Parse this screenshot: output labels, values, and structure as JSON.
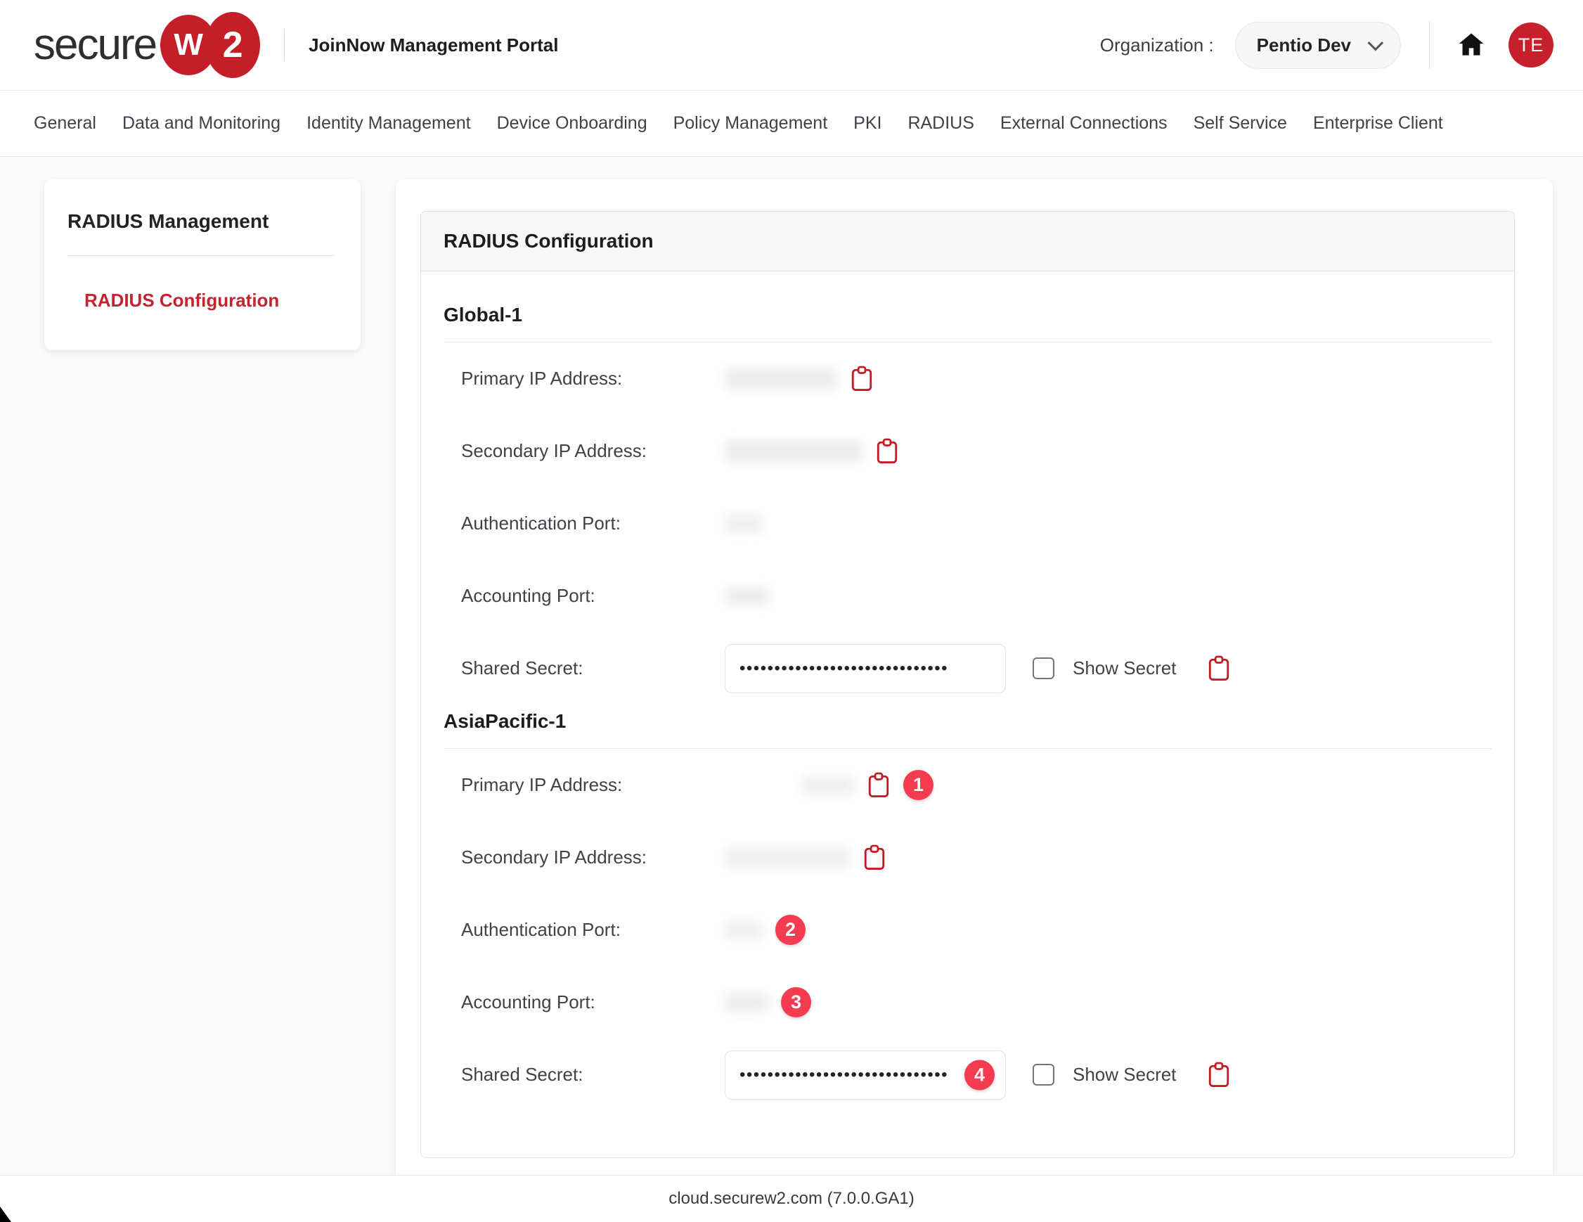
{
  "brand": {
    "logo_word": "secure",
    "logo_w": "W",
    "logo_2": "2",
    "portal_title": "JoinNow Management Portal"
  },
  "header": {
    "organization_label": "Organization :",
    "organization_value": "Pentio Dev",
    "avatar_initials": "TE"
  },
  "nav": {
    "items": [
      {
        "label": "General"
      },
      {
        "label": "Data and Monitoring"
      },
      {
        "label": "Identity Management"
      },
      {
        "label": "Device Onboarding"
      },
      {
        "label": "Policy Management"
      },
      {
        "label": "PKI"
      },
      {
        "label": "RADIUS"
      },
      {
        "label": "External Connections"
      },
      {
        "label": "Self Service"
      },
      {
        "label": "Enterprise Client"
      }
    ]
  },
  "sidebar": {
    "title": "RADIUS Management",
    "items": [
      {
        "label": "RADIUS Configuration",
        "active": true
      }
    ]
  },
  "main": {
    "panel_title": "RADIUS Configuration",
    "sections": [
      {
        "name": "Global-1",
        "rows": [
          {
            "label": "Primary IP Address:",
            "value": "redacted",
            "clipboard": true
          },
          {
            "label": "Secondary IP Address:",
            "value": "redacted",
            "clipboard": true
          },
          {
            "label": "Authentication Port:",
            "value": "redacted"
          },
          {
            "label": "Accounting Port:",
            "value": "redacted"
          },
          {
            "label": "Shared Secret:",
            "value": "masked",
            "secret_mask": "••••••••••••••••••••••••••••••",
            "show_secret": "Show Secret",
            "clipboard": true
          }
        ]
      },
      {
        "name": "AsiaPacific-1",
        "rows": [
          {
            "label": "Primary IP Address:",
            "value": "redacted",
            "clipboard": true,
            "badge": "1"
          },
          {
            "label": "Secondary IP Address:",
            "value": "redacted",
            "clipboard": true
          },
          {
            "label": "Authentication Port:",
            "value": "redacted",
            "badge": "2"
          },
          {
            "label": "Accounting Port:",
            "value": "redacted",
            "badge": "3"
          },
          {
            "label": "Shared Secret:",
            "value": "masked",
            "secret_mask": "••••••••••••••••••••••••••••••",
            "badge": "4",
            "show_secret": "Show Secret",
            "clipboard": true
          }
        ]
      }
    ]
  },
  "footer": {
    "text": "cloud.securew2.com (7.0.0.GA1)"
  },
  "colors": {
    "accent_red": "#c42430",
    "badge_red": "#f43b50",
    "avatar_red": "#c5202b",
    "logo_red": "#c41e28"
  }
}
